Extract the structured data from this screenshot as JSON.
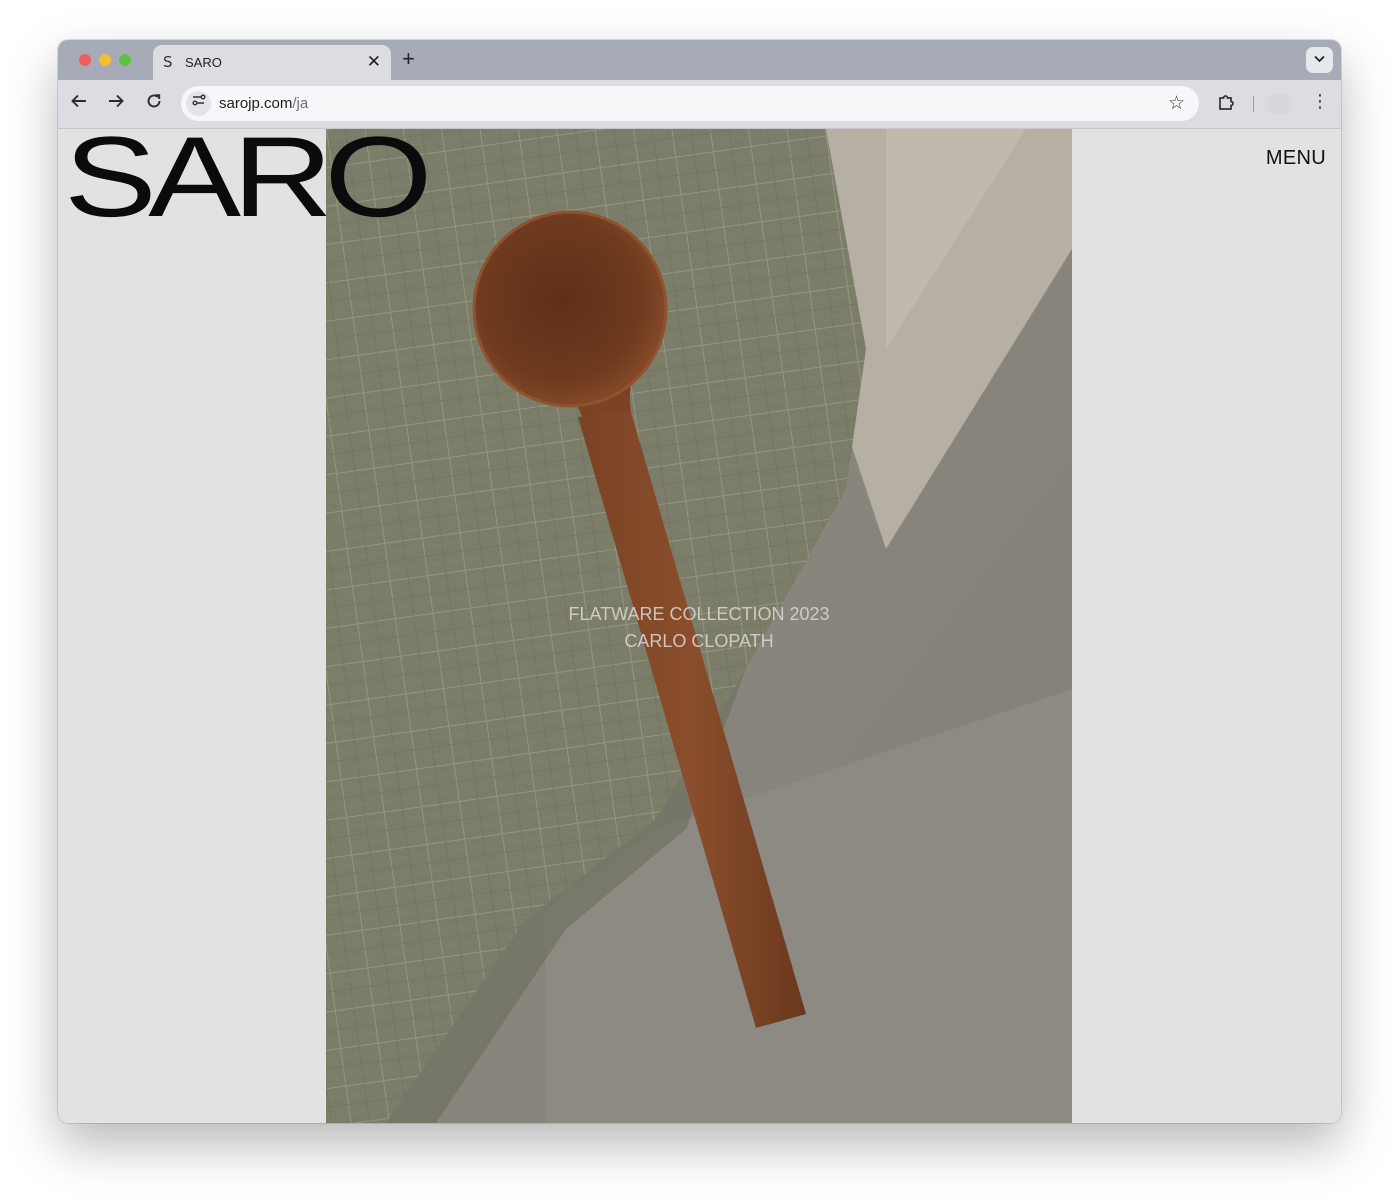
{
  "browser": {
    "tab": {
      "favicon": "S",
      "title": "SARO"
    },
    "url": {
      "host": "sarojp.com",
      "path": "/ja"
    },
    "icons": {
      "back": "arrow-left-icon",
      "forward": "arrow-right-icon",
      "reload": "reload-icon",
      "site_info": "tune-icon",
      "bookmark": "star-icon",
      "extensions": "puzzle-icon",
      "menu": "kebab-icon",
      "new_tab": "plus-icon",
      "close_tab": "close-icon",
      "tab_search": "chevron-down-icon"
    }
  },
  "site": {
    "logo": "SARO",
    "menu_label": "MENU",
    "hero": {
      "caption_line1": "FLATWARE COLLECTION 2023",
      "caption_line2": "CARLO CLOPATH",
      "image_subject": "wooden-spoon-on-linen"
    }
  },
  "colors": {
    "page_bg": "#e2e2e3",
    "tabbar_bg": "#a7aab7",
    "toolbar_bg": "#dcdde3",
    "logo": "#0b0b0b",
    "spoon_wood": "#6e3a20",
    "cloth_green": "#7a7b68",
    "cloth_grey": "#8a877f"
  }
}
